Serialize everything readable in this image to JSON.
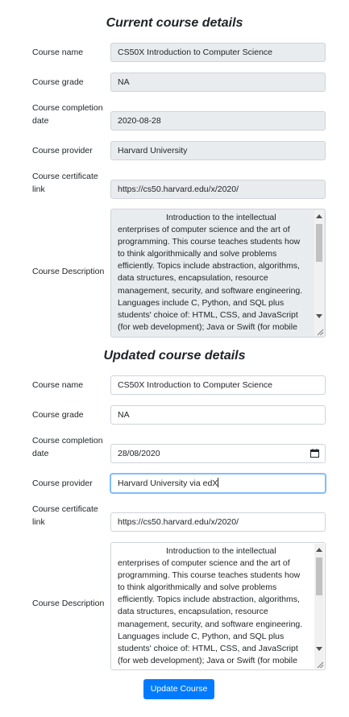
{
  "current": {
    "heading": "Current course details",
    "course_name_label": "Course name",
    "course_name": "CS50X Introduction to Computer Science",
    "course_grade_label": "Course grade",
    "course_grade": "NA",
    "completion_date_label": "Course completion date",
    "completion_date": "2020-08-28",
    "provider_label": "Course provider",
    "provider": "Harvard University",
    "certificate_label": "Course certificate link",
    "certificate": "https://cs50.harvard.edu/x/2020/",
    "description_label": "Course Description",
    "description": "Introduction to the intellectual enterprises of computer science and the art of programming. This course teaches students how to think algorithmically and solve problems efficiently. Topics include abstraction, algorithms, data structures, encapsulation, resource management, security, and software engineering. Languages include C, Python, and SQL plus students' choice of: HTML, CSS, and JavaScript (for web development); Java or Swift (for mobile"
  },
  "updated": {
    "heading": "Updated course details",
    "course_name_label": "Course name",
    "course_name": "CS50X Introduction to Computer Science",
    "course_grade_label": "Course grade",
    "course_grade": "NA",
    "completion_date_label": "Course completion date",
    "completion_date": "28/08/2020",
    "provider_label": "Course provider",
    "provider": "Harvard University via edX",
    "certificate_label": "Course certificate link",
    "certificate": "https://cs50.harvard.edu/x/2020/",
    "description_label": "Course Description",
    "description": "Introduction to the intellectual enterprises of computer science and the art of programming. This course teaches students how to think algorithmically and solve problems efficiently. Topics include abstraction, algorithms, data structures, encapsulation, resource management, security, and software engineering. Languages include C, Python, and SQL plus students' choice of: HTML, CSS, and JavaScript (for web development); Java or Swift (for mobile"
  },
  "submit_label": "Update Course",
  "icons": {
    "calendar": "calendar-icon",
    "scroll_up": "scroll-up-arrow-icon",
    "scroll_down": "scroll-down-arrow-icon",
    "resize": "resize-handle-icon"
  },
  "colors": {
    "readonly_bg": "#e9ecef",
    "border": "#ced4da",
    "focus_border": "#80bdff",
    "primary": "#007bff"
  }
}
